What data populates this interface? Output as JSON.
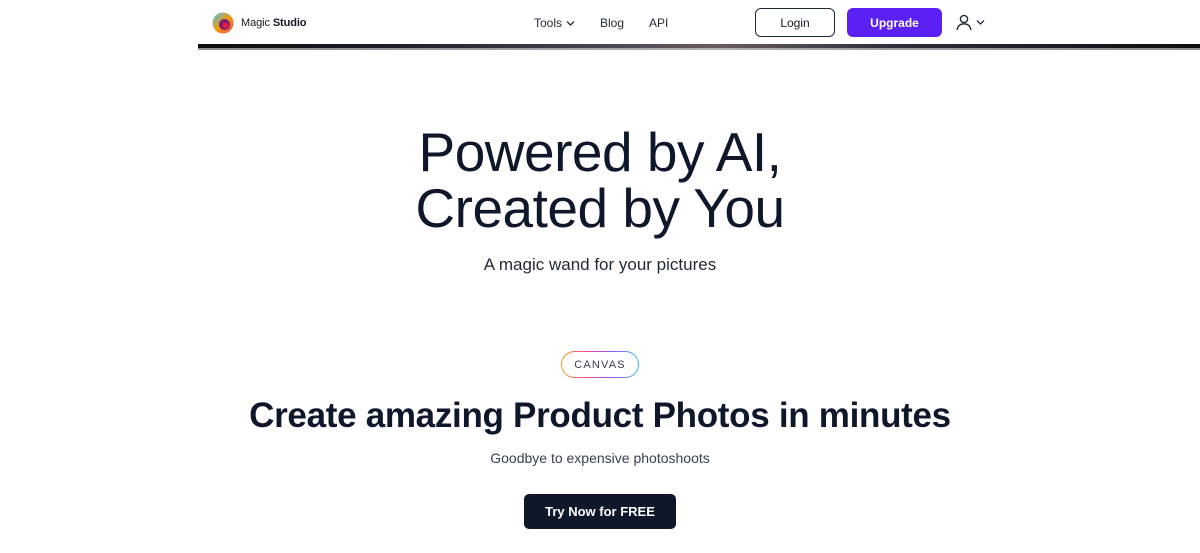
{
  "brand": {
    "name_light": "Magic ",
    "name_bold": "Studio",
    "logo_icon": "magic-studio-logo-icon"
  },
  "nav": {
    "tools_label": "Tools",
    "blog_label": "Blog",
    "api_label": "API",
    "login_label": "Login",
    "upgrade_label": "Upgrade",
    "user_icon": "user-icon",
    "chevron_icon": "chevron-down-icon"
  },
  "hero": {
    "title_line1": "Powered by AI,",
    "title_line2": "Created by You",
    "subtitle": "A magic wand for your pictures"
  },
  "section": {
    "badge": "CANVAS",
    "title": "Create amazing Product Photos in minutes",
    "subtitle": "Goodbye to expensive photoshoots",
    "cta_label": "Try Now for FREE"
  },
  "colors": {
    "accent": "#5b21f4",
    "dark": "#0f172a",
    "text": "#1f2937"
  }
}
